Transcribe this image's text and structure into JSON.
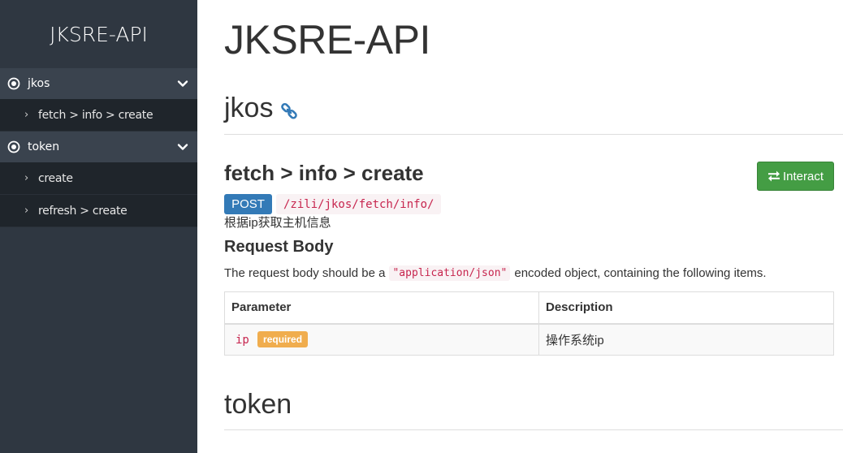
{
  "sidebar": {
    "title": "JKSRE-API",
    "sections": [
      {
        "label": "jkos",
        "icon": "target-icon",
        "chevron": "chevron-down-icon",
        "items": [
          {
            "label": "fetch > info > create"
          }
        ]
      },
      {
        "label": "token",
        "icon": "target-icon",
        "chevron": "chevron-down-icon",
        "items": [
          {
            "label": "create"
          },
          {
            "label": "refresh > create"
          }
        ]
      }
    ]
  },
  "main": {
    "title": "JKSRE-API",
    "groups": [
      {
        "title": "jkos",
        "icon": "link-icon"
      },
      {
        "title": "token"
      }
    ],
    "endpoint": {
      "title": "fetch > info > create",
      "interact_label": "Interact",
      "interact_icon": "swap-arrows-icon",
      "method": "POST",
      "url": "/zili/jkos/fetch/info/",
      "description": "根据ip获取主机信息",
      "request_body_heading": "Request Body",
      "request_text_before": "The request body should be a",
      "request_content_type": "\"application/json\"",
      "request_text_after": "encoded object, containing the following items.",
      "table": {
        "headers": [
          "Parameter",
          "Description"
        ],
        "rows": [
          {
            "name": "ip",
            "badge": "required",
            "description": "操作系统ip"
          }
        ]
      }
    }
  },
  "colors": {
    "sidebar_bg": "#2f3741",
    "sidebar_section_bg": "#3a434e",
    "sidebar_sublist_bg": "#1f252b",
    "interact_green": "#449d44",
    "post_blue": "#337ab7",
    "code_red": "#c7254e",
    "required_orange": "#f0ad4e"
  }
}
